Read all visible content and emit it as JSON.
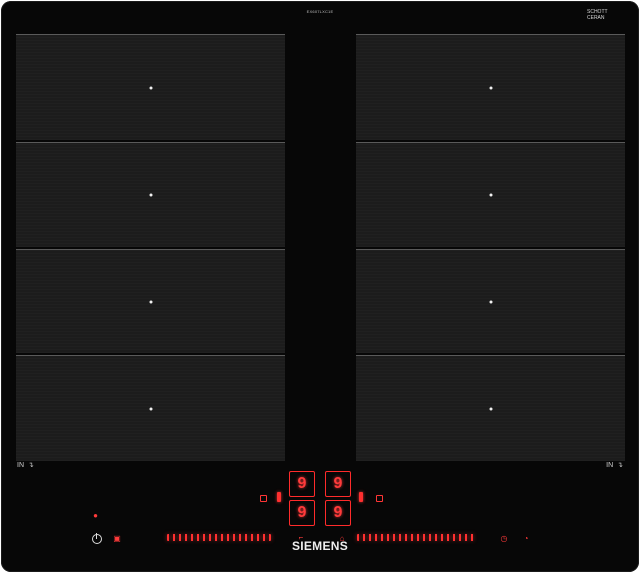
{
  "model": "EX607LXC1E",
  "logo": {
    "line1": "SCHOTT",
    "line2": "CERAN",
    "line3": ""
  },
  "left_label": "IN",
  "right_label": "IN",
  "brand": "SIEMENS",
  "display": {
    "tl": "9",
    "tr": "9",
    "bl": "9",
    "br": "9"
  },
  "colors": {
    "accent_red": "#ff2b2b",
    "glass": "#070707"
  },
  "icons": {
    "power": "power-icon",
    "timer_left": "timer-icon",
    "lock": "lock-icon",
    "timer_right": "timer-icon",
    "clock": "clock-icon"
  }
}
